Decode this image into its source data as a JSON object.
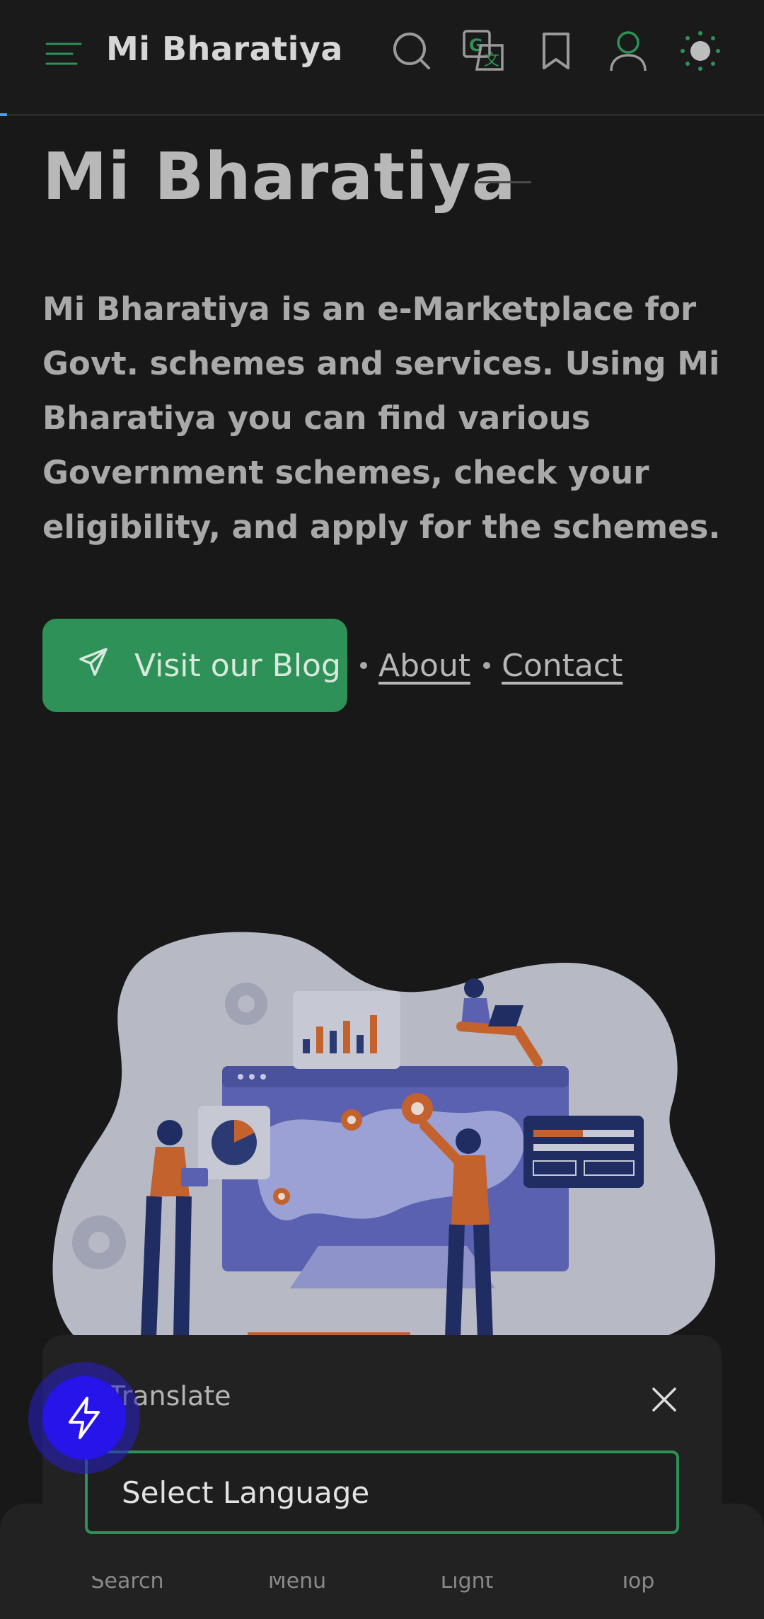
{
  "header": {
    "brand": "Mi Bharatiya",
    "icons": [
      "menu-icon",
      "search-icon",
      "translate-icon",
      "bookmark-icon",
      "user-icon",
      "theme-icon"
    ]
  },
  "hero": {
    "title": "Mi Bharatiya",
    "description": "Mi Bharatiya is an e-Marketplace for Govt. schemes and services. Using Mi Bharatiya you can find various Government schemes, check your eligibility, and apply for the schemes.",
    "blog_button": "Visit our Blog",
    "about_link": "About",
    "contact_link": "Contact"
  },
  "translate": {
    "title": "Translate",
    "select_placeholder": "Select Language"
  },
  "bottom_nav": {
    "items": [
      {
        "label": "Search"
      },
      {
        "label": "Menu"
      },
      {
        "label": "Light"
      },
      {
        "label": "Top"
      }
    ]
  },
  "colors": {
    "background": "#181818",
    "accent_green": "#2e9157",
    "fab_blue": "#2614e8"
  }
}
